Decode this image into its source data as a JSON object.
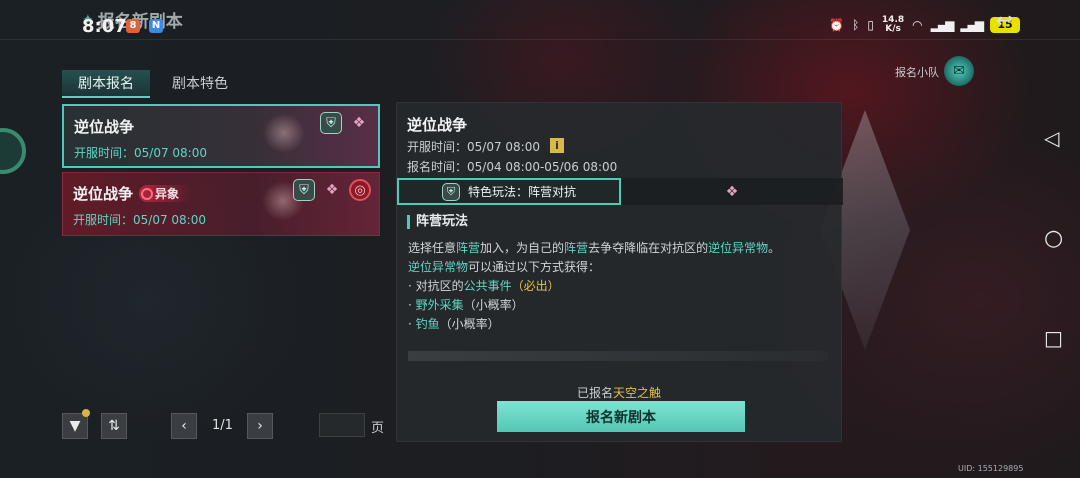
{
  "status_bar": {
    "time": "8:07",
    "notif_1": "8",
    "notif_2": "N",
    "net_speed_value": "14.8",
    "net_speed_unit": "K/s",
    "battery": "15"
  },
  "header": {
    "title": "报名新剧本"
  },
  "tabs": [
    {
      "label": "剧本报名",
      "active": true
    },
    {
      "label": "剧本特色",
      "active": false
    }
  ],
  "team": {
    "label": "报名小队"
  },
  "scripts": [
    {
      "name": "逆位战争",
      "open_time": "开服时间：05/07 08:00",
      "tag": "",
      "selected": true
    },
    {
      "name": "逆位战争",
      "open_time": "开服时间：05/07 08:00",
      "tag": "异象",
      "selected": false
    }
  ],
  "pagination": {
    "current": "1/1",
    "unit": "页",
    "input_value": ""
  },
  "detail": {
    "title": "逆位战争",
    "open_time": "开服时间：05/07 08:00",
    "info_icon": "i",
    "register_time": "报名时间：05/04 08:00-05/06 08:00",
    "feature_tab": "特色玩法：阵营对抗",
    "section_title": "阵营玩法",
    "line1": {
      "a": "选择任意",
      "b": "阵营",
      "c": "加入，为自己的",
      "d": "阵营",
      "e": "去争夺降临在对抗区的",
      "f": "逆位异常物",
      "g": "。"
    },
    "line2": {
      "a": "逆位异常物",
      "b": "可以通过以下方式获得："
    },
    "line3": {
      "a": "· 对抗区的",
      "b": "公共事件",
      "c": "（必出）"
    },
    "line4": {
      "a": "· ",
      "b": "野外采集",
      "c": "（小概率）"
    },
    "line5": {
      "a": "· ",
      "b": "钓鱼",
      "c": "（小概率）"
    },
    "registered_prefix": "已报名",
    "registered_server": "天空之触",
    "register_button": "报名新剧本"
  },
  "uid": "UID: 155129895",
  "colors": {
    "accent": "#4fc9b8",
    "highlight": "#5fd6c4",
    "gold": "#e4bd55",
    "button": "#6fdcc9"
  },
  "icons": [
    "shield-icon",
    "gems-icon",
    "red-swirl-icon",
    "filter-icon",
    "sort-icon",
    "chevron-left-icon",
    "chevron-right-icon",
    "info-icon",
    "team-mail-icon",
    "back-icon"
  ]
}
